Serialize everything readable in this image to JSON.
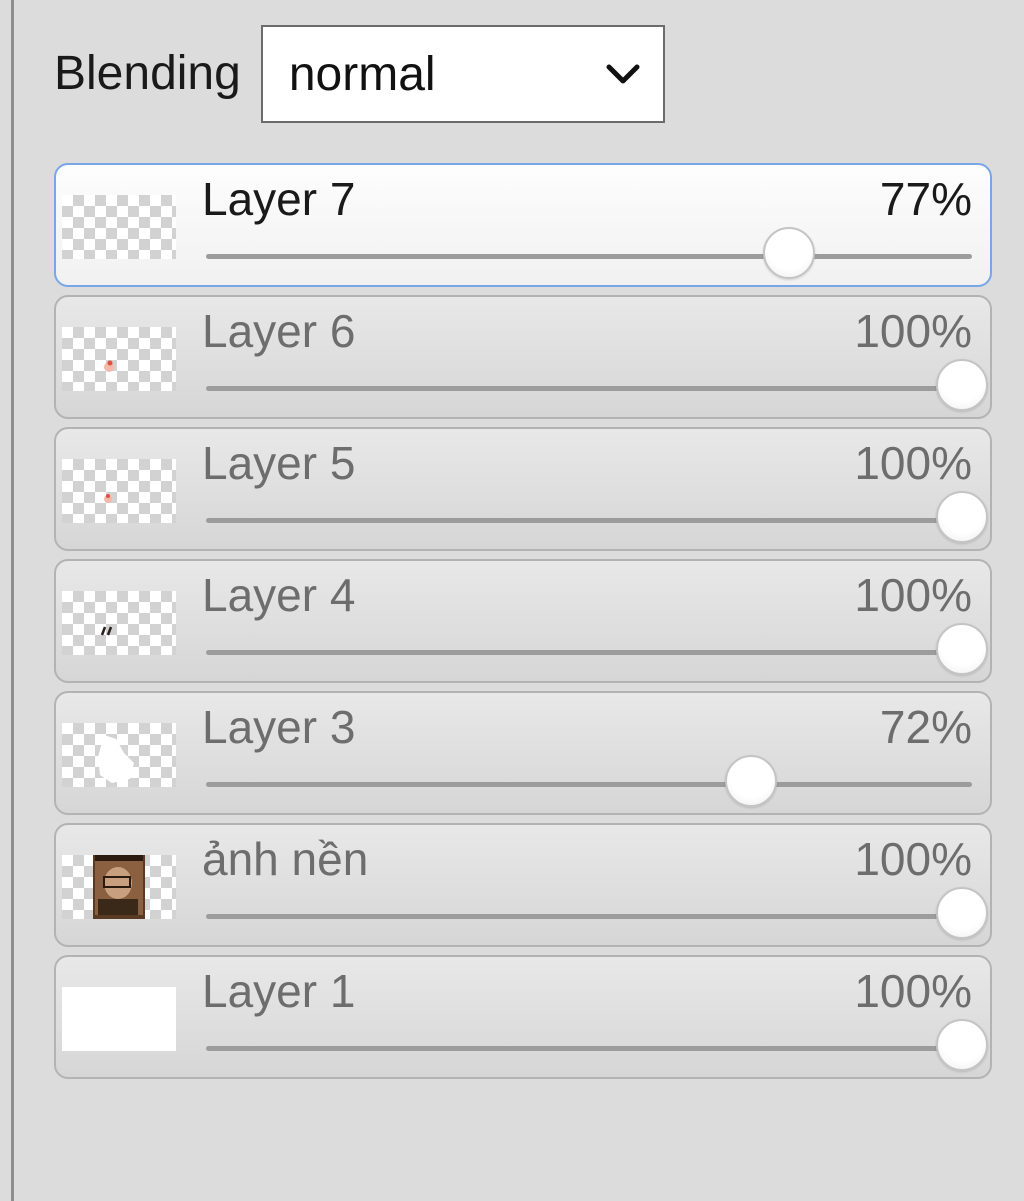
{
  "blending": {
    "label": "Blending",
    "selected": "normal"
  },
  "layers": [
    {
      "name": "Layer 7",
      "opacity_text": "77%",
      "opacity": 0.77,
      "selected": true,
      "thumb": "transparent-dots"
    },
    {
      "name": "Layer 6",
      "opacity_text": "100%",
      "opacity": 1.0,
      "selected": false,
      "thumb": "transparent-red-mark"
    },
    {
      "name": "Layer 5",
      "opacity_text": "100%",
      "opacity": 1.0,
      "selected": false,
      "thumb": "transparent-red-mark"
    },
    {
      "name": "Layer 4",
      "opacity_text": "100%",
      "opacity": 1.0,
      "selected": false,
      "thumb": "transparent-dark-mark"
    },
    {
      "name": "Layer 3",
      "opacity_text": "72%",
      "opacity": 0.72,
      "selected": false,
      "thumb": "transparent-white-shape"
    },
    {
      "name": "ảnh nền",
      "opacity_text": "100%",
      "opacity": 1.0,
      "selected": false,
      "thumb": "photo-portrait"
    },
    {
      "name": "Layer 1",
      "opacity_text": "100%",
      "opacity": 1.0,
      "selected": false,
      "thumb": "solid-white"
    }
  ],
  "colors": {
    "panel_bg": "#dcdcdc",
    "selected_border": "#7aa6e8"
  }
}
